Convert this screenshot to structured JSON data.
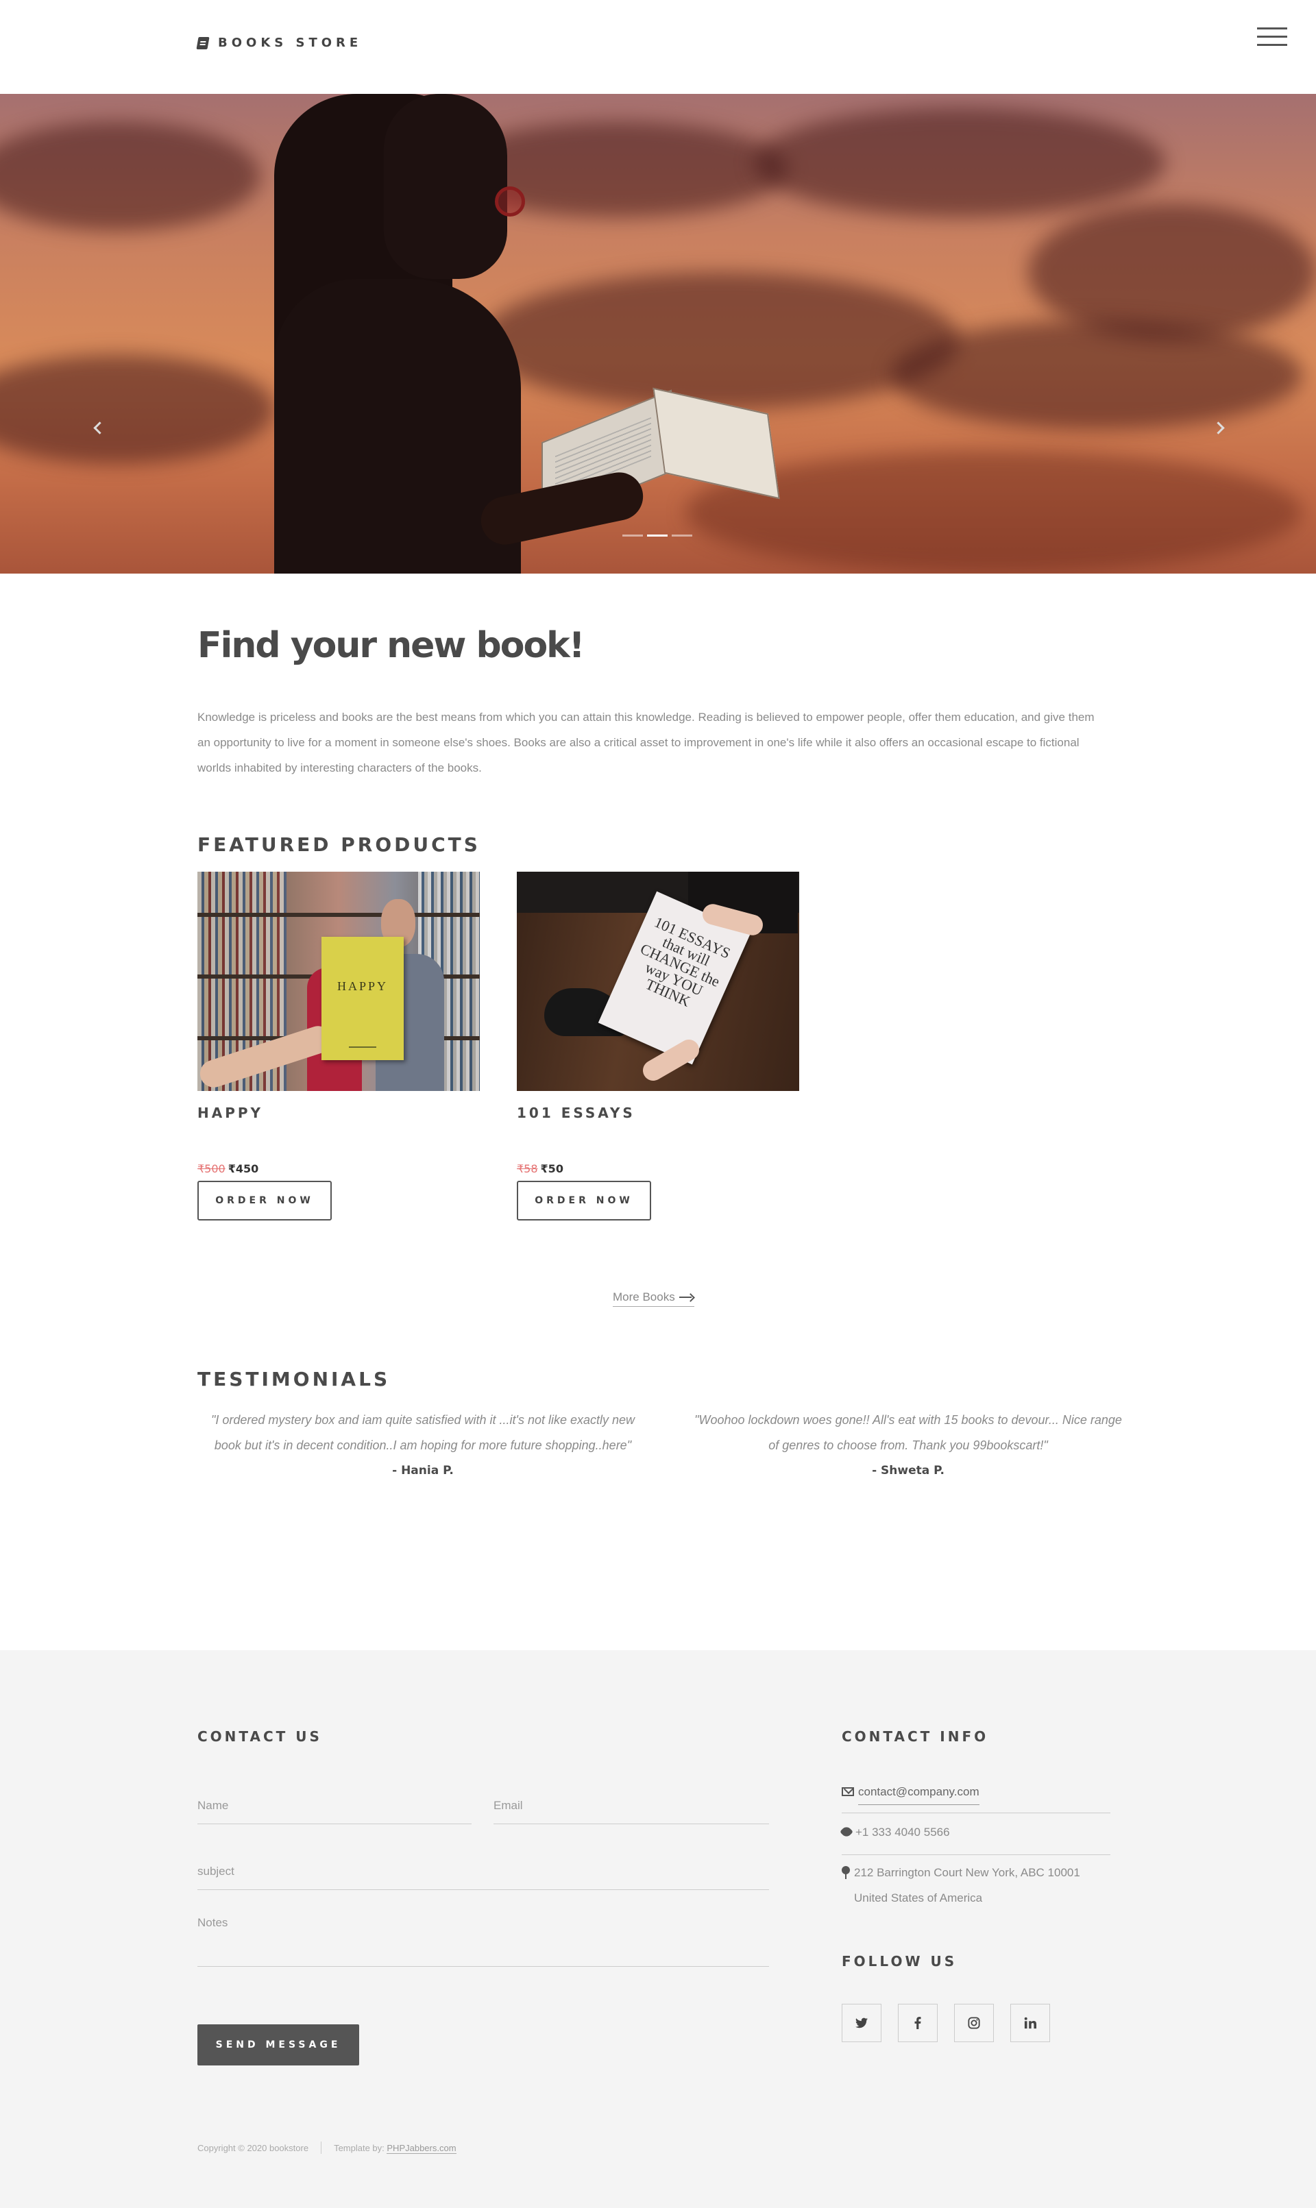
{
  "header": {
    "logo_text": "BOOKS STORE",
    "logo_icon": "book-icon",
    "menu_icon": "hamburger-menu-icon"
  },
  "hero": {
    "prev_icon": "chevron-left-icon",
    "next_icon": "chevron-right-icon",
    "slides": 3,
    "active_slide": 2
  },
  "intro": {
    "title": "Find your new book!",
    "text": "Knowledge is priceless and books are the best means from which you can attain this knowledge. Reading is believed to empower people, offer them education, and give them an opportunity to live for a moment in someone else's shoes. Books are also a critical asset to improvement in one's life while it also offers an occasional escape to fictional worlds inhabited by interesting characters of the books."
  },
  "featured": {
    "title": "FEATURED PRODUCTS",
    "products": [
      {
        "name": "HAPPY",
        "cover_text": "HAPPY",
        "old_price": "₹500",
        "price": "₹450",
        "button": "ORDER NOW"
      },
      {
        "name": "101 ESSAYS",
        "cover_text": "101 ESSAYS that will CHANGE the way YOU THINK",
        "old_price": "₹58",
        "price": "₹50",
        "button": "ORDER NOW"
      }
    ],
    "more_link": "More Books"
  },
  "testimonials": {
    "title": "TESTIMONIALS",
    "items": [
      {
        "quote": "\"I ordered mystery box and iam quite satisfied with it ...it's not like exactly new book but it's in decent condition..I am hoping for more future shopping..here\"",
        "author": "- Hania P."
      },
      {
        "quote": "\"Woohoo lockdown woes gone!! All's eat with 15 books to devour... Nice range of genres to choose from. Thank you 99bookscart!\"",
        "author": "- Shweta P."
      }
    ]
  },
  "contact": {
    "title": "CONTACT US",
    "name_placeholder": "Name",
    "email_placeholder": "Email",
    "subject_placeholder": "subject",
    "notes_placeholder": "Notes",
    "send_button": "SEND MESSAGE"
  },
  "contact_info": {
    "title": "CONTACT INFO",
    "email": "contact@company.com",
    "phone": "+1 333 4040 5566",
    "address": "212 Barrington Court New York, ABC 10001 United States of America"
  },
  "follow": {
    "title": "FOLLOW US",
    "icons": [
      "twitter-icon",
      "facebook-icon",
      "instagram-icon",
      "linkedin-icon"
    ]
  },
  "footer": {
    "copyright": "Copyright © 2020 bookstore",
    "template_by": "Template by:",
    "template_link": "PHPJabbers.com"
  },
  "colors": {
    "text_dark": "#4a4a4a",
    "text_muted": "#8a8a8a",
    "old_price": "#e57373",
    "button_dark": "#555555",
    "footer_bg": "#f4f4f4"
  }
}
